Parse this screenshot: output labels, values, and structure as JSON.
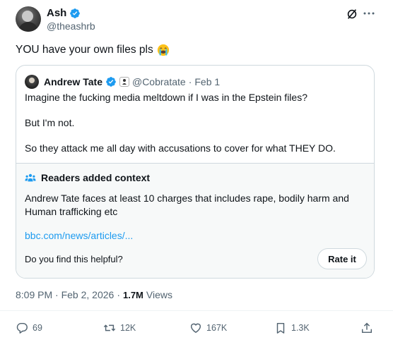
{
  "post": {
    "author_name": "Ash",
    "author_handle": "@theashrb",
    "text": "YOU have your own files pls",
    "emoji": "loudly-crying-face",
    "timestamp": "8:09 PM · Feb 2, 2026",
    "views_separator": "·",
    "views_count": "1.7M",
    "views_label": "Views"
  },
  "quote": {
    "author_name": "Andrew Tate",
    "author_handle": "@Cobratate",
    "separator": "·",
    "date": "Feb 1",
    "lines": [
      "Imagine the fucking media meltdown if I was in the Epstein files?",
      "But I'm not.",
      "So they attack me all day with accusations to cover for what THEY DO."
    ]
  },
  "context": {
    "title": "Readers added context",
    "text": "Andrew Tate faces at least 10 charges that includes rape, bodily harm and Human trafficking etc",
    "link": "bbc.com/news/articles/...",
    "question": "Do you find this helpful?",
    "rate_label": "Rate it"
  },
  "actions": {
    "replies": "69",
    "reposts": "12K",
    "likes": "167K",
    "bookmarks": "1.3K"
  },
  "colors": {
    "verified": "#1d9bf0",
    "link": "#1d9bf0",
    "muted": "#536471",
    "border": "#cfd9de",
    "context_bg": "#f7f9f9"
  }
}
